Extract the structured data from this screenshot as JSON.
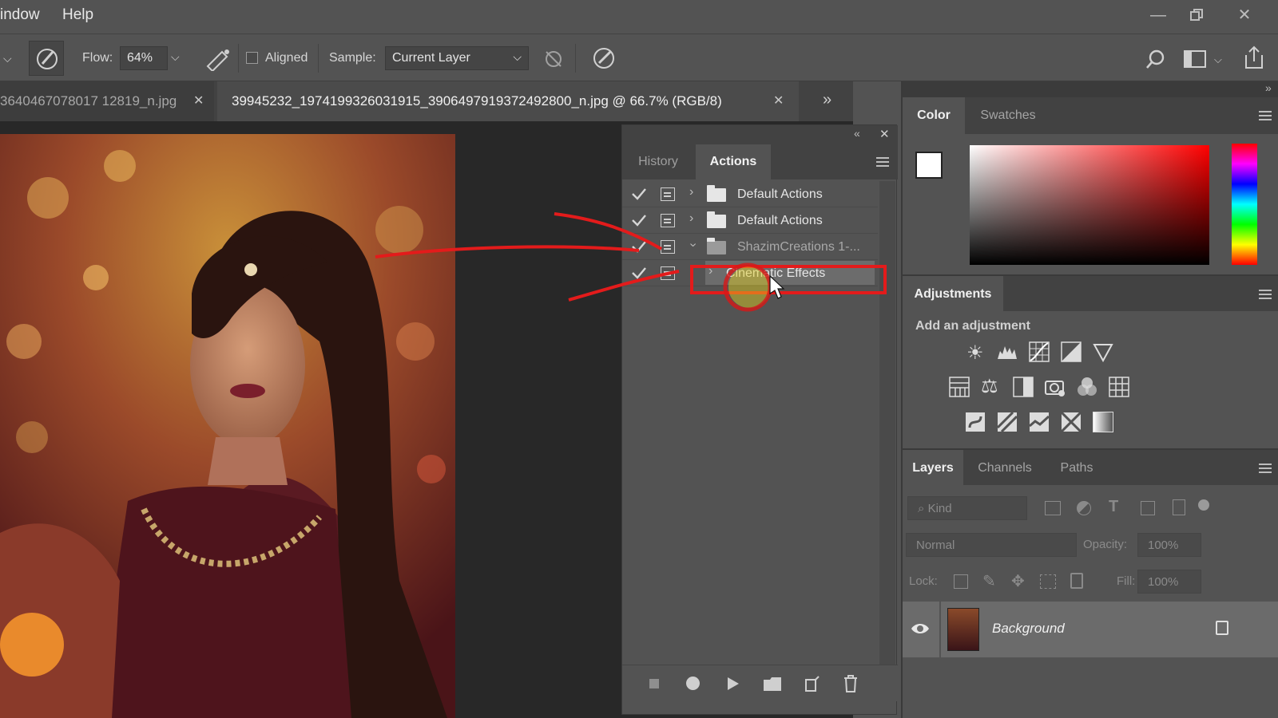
{
  "menu": {
    "items": [
      "indow",
      "Help"
    ]
  },
  "options_bar": {
    "flow_label": "Flow:",
    "flow_value": "64%",
    "aligned_label": "Aligned",
    "sample_label": "Sample:",
    "sample_value": "Current Layer"
  },
  "tabs": [
    {
      "label": "3640467078017 12819_n.jpg"
    },
    {
      "label": "39945232_1974199326031915_3906497919372492800_n.jpg @ 66.7% (RGB/8)"
    }
  ],
  "actions_panel": {
    "tabs": [
      "History",
      "Actions"
    ],
    "rows": [
      {
        "label": "Default Actions"
      },
      {
        "label": "Default Actions"
      },
      {
        "label": "ShazimCreations 1-..."
      },
      {
        "label": "Cinematic Effects"
      }
    ]
  },
  "color_panel": {
    "tabs": [
      "Color",
      "Swatches"
    ]
  },
  "adjustments_panel": {
    "title": "Adjustments",
    "subtitle": "Add an adjustment"
  },
  "layers_panel": {
    "tabs": [
      "Layers",
      "Channels",
      "Paths"
    ],
    "kind_label": "Kind",
    "blend_mode": "Normal",
    "opacity_label": "Opacity:",
    "opacity_value": "100%",
    "lock_label": "Lock:",
    "fill_label": "Fill:",
    "fill_value": "100%",
    "layers": [
      {
        "name": "Background"
      }
    ]
  },
  "colors": {
    "accent_red": "#e31b1b",
    "panel_bg": "#535353",
    "canvas_bg": "#282828"
  }
}
